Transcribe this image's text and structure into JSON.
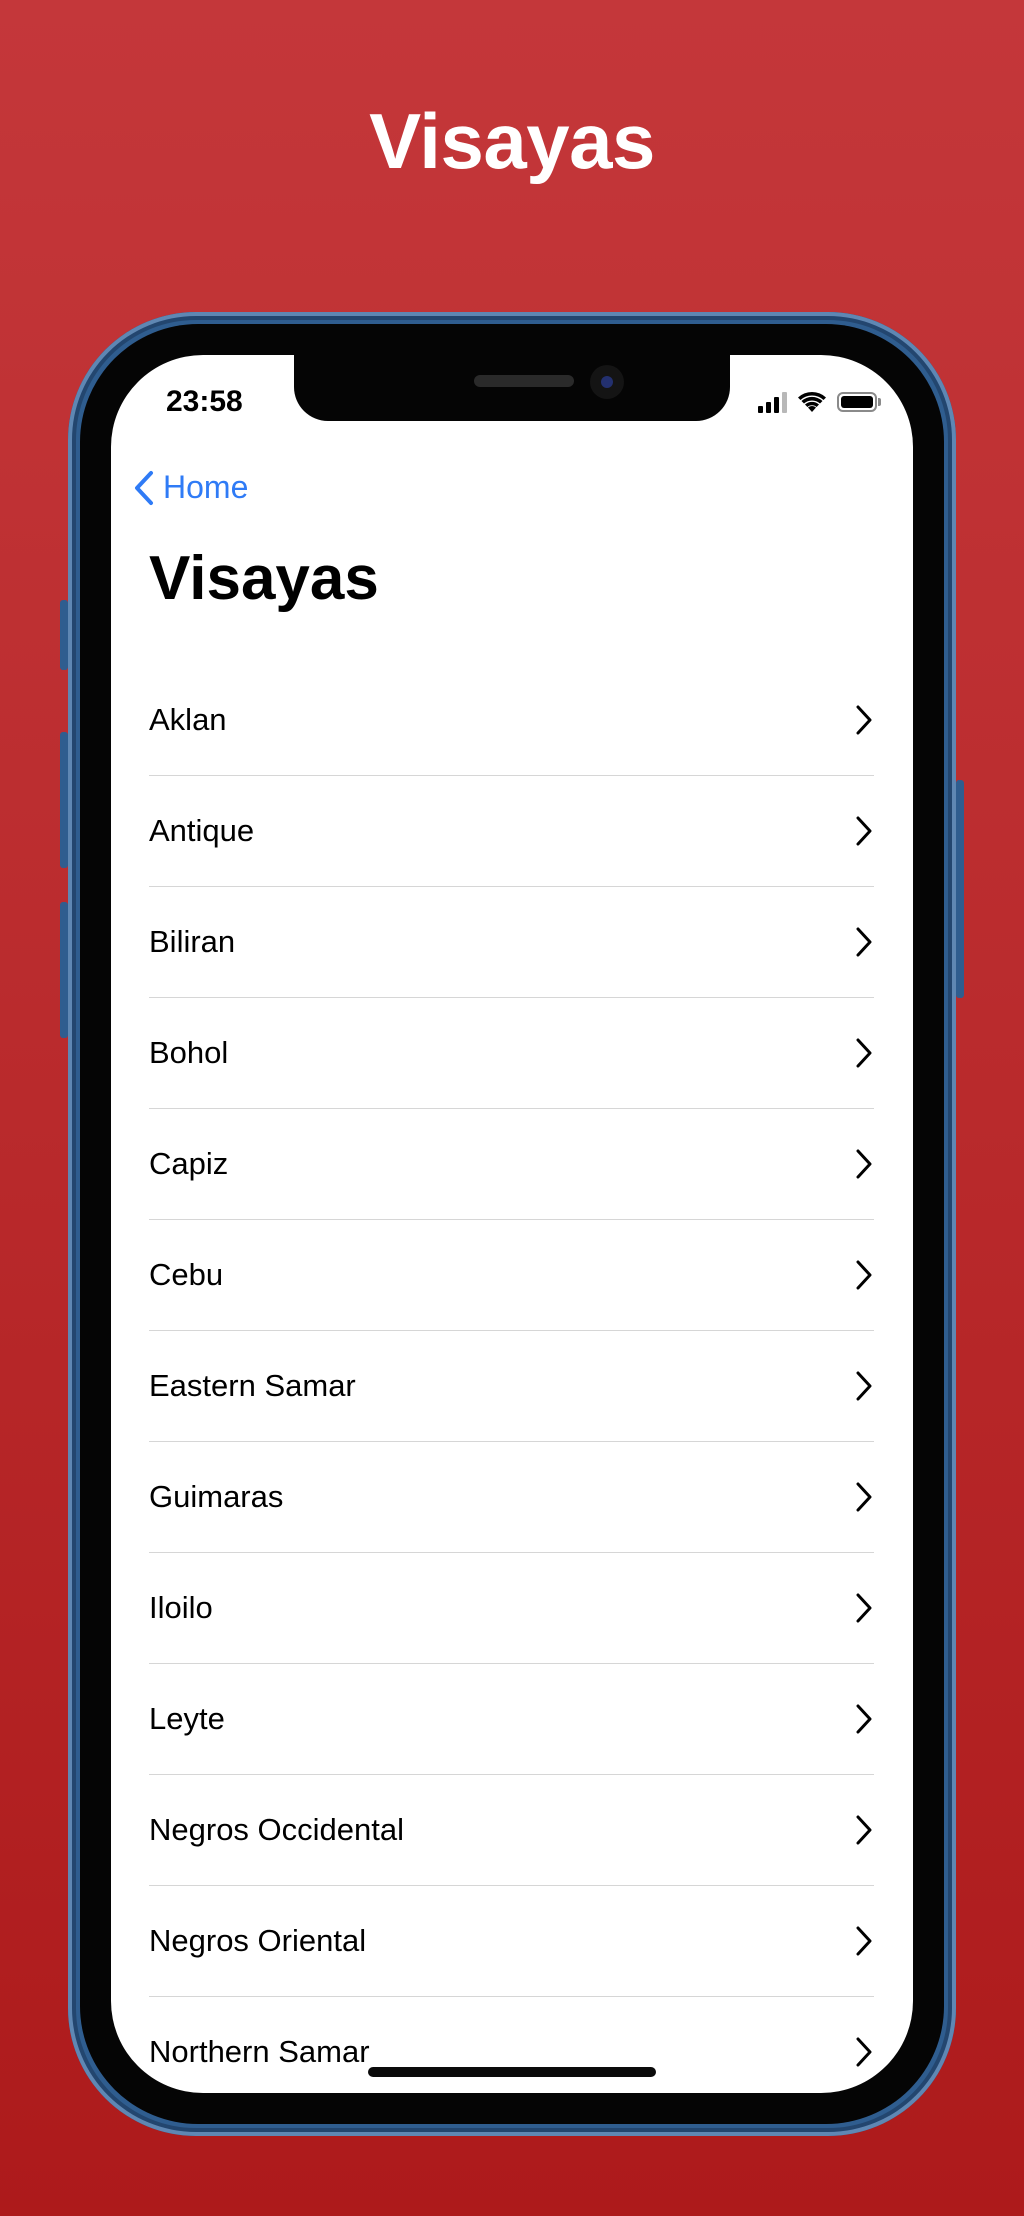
{
  "hero": {
    "title": "Visayas"
  },
  "status_bar": {
    "time": "23:58"
  },
  "nav": {
    "back_label": "Home",
    "title": "Visayas"
  },
  "provinces": [
    "Aklan",
    "Antique",
    "Biliran",
    "Bohol",
    "Capiz",
    "Cebu",
    "Eastern Samar",
    "Guimaras",
    "Iloilo",
    "Leyte",
    "Negros Occidental",
    "Negros Oriental",
    "Northern Samar"
  ],
  "colors": {
    "background": "#b92a2c",
    "accent": "#2f7bf6",
    "frame": "#2f5d8f"
  },
  "icons": {
    "back": "chevron-left-icon",
    "row": "chevron-right-icon"
  }
}
